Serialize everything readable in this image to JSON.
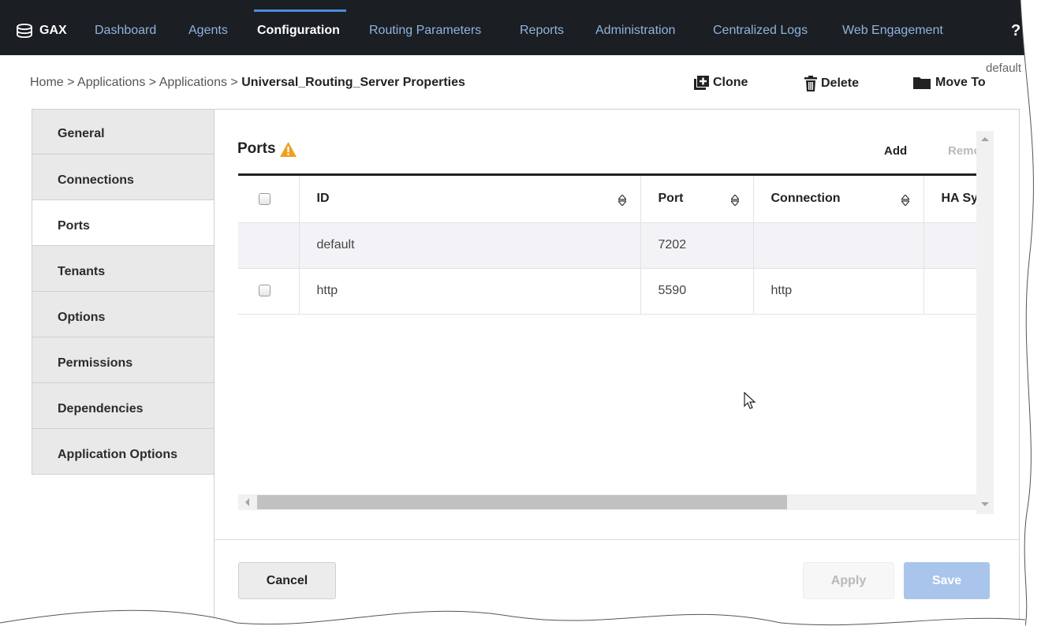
{
  "topnav": {
    "brand": "GAX",
    "items": [
      {
        "label": "Dashboard",
        "active": false
      },
      {
        "label": "Agents",
        "active": false
      },
      {
        "label": "Configuration",
        "active": true
      },
      {
        "label": "Routing Parameters",
        "active": false
      },
      {
        "label": "Reports",
        "active": false
      },
      {
        "label": "Administration",
        "active": false
      },
      {
        "label": "Centralized Logs",
        "active": false
      },
      {
        "label": "Web Engagement",
        "active": false
      }
    ],
    "help": "?"
  },
  "header": {
    "breadcrumb": {
      "home": "Home",
      "sep": ">",
      "level1": "Applications",
      "level2": "Applications",
      "current": "Universal_Routing_Server Properties"
    },
    "actions": {
      "clone": "Clone",
      "delete": "Delete",
      "move_to": "Move To"
    },
    "tenant": "default"
  },
  "sidebar": {
    "items": [
      {
        "label": "General"
      },
      {
        "label": "Connections"
      },
      {
        "label": "Ports",
        "active": true
      },
      {
        "label": "Tenants"
      },
      {
        "label": "Options"
      },
      {
        "label": "Permissions"
      },
      {
        "label": "Dependencies"
      },
      {
        "label": "Application Options"
      }
    ]
  },
  "ports": {
    "title": "Ports",
    "warning_icon": "warning-triangle-icon",
    "add_label": "Add",
    "remove_label": "Remove",
    "columns": [
      "ID",
      "Port",
      "Connection",
      "HA Sync"
    ],
    "rows": [
      {
        "id": "default",
        "port": "7202",
        "connection": "",
        "ha": "",
        "checkbox": false
      },
      {
        "id": "http",
        "port": "5590",
        "connection": "http",
        "ha": "",
        "checkbox": true
      }
    ]
  },
  "footer": {
    "cancel": "Cancel",
    "apply": "Apply",
    "save": "Save"
  },
  "colors": {
    "nav_bg": "#1b1e22",
    "nav_link": "#8fb4de",
    "accent": "#4a8fd8",
    "warning": "#f0a020",
    "save_disabled": "#a9c5ec"
  }
}
